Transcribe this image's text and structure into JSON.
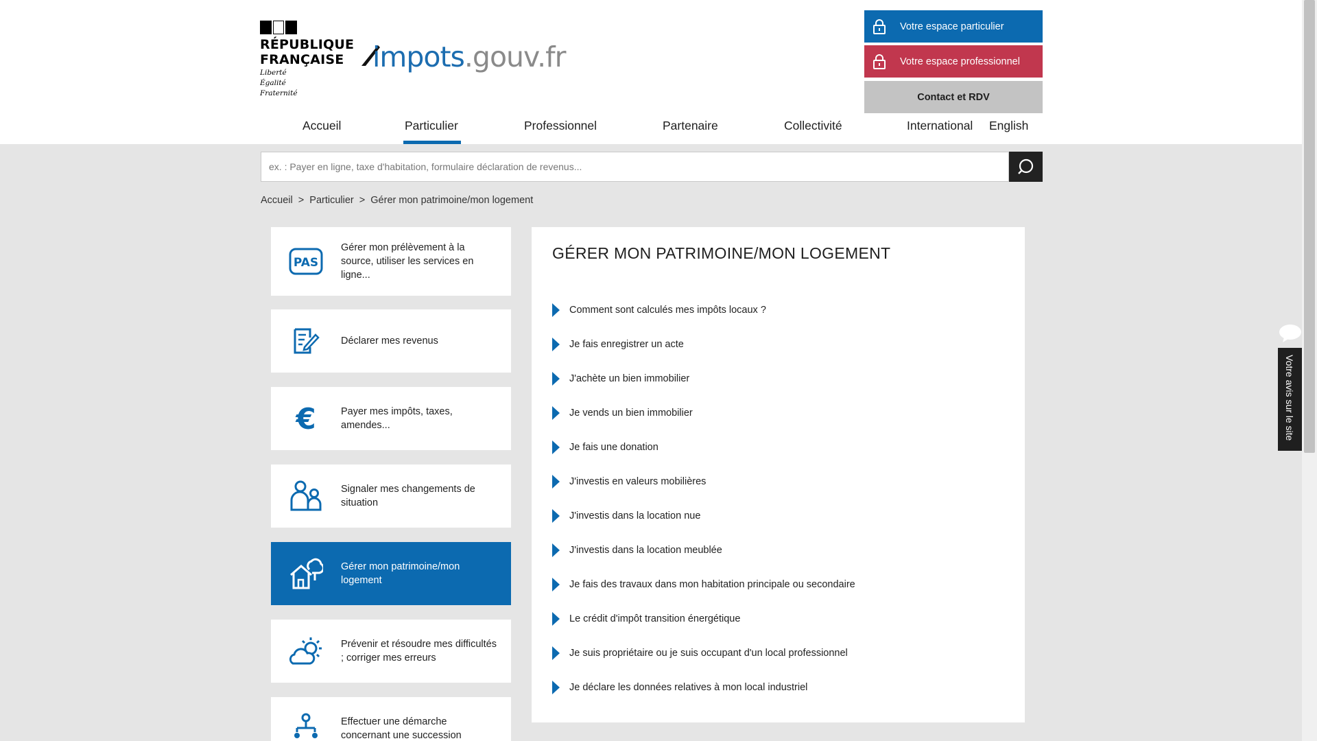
{
  "header": {
    "republic_line1": "RÉPUBLIQUE",
    "republic_line2": "FRANÇAISE",
    "motto": [
      "Liberté",
      "Égalité",
      "Fraternité"
    ],
    "logo_text_main": "impots",
    "logo_text_domain": ".gouv.fr",
    "buttons": {
      "particulier": "Votre espace particulier",
      "professionnel": "Votre espace professionnel",
      "contact": "Contact et RDV"
    },
    "nav": [
      "Accueil",
      "Particulier",
      "Professionnel",
      "Partenaire",
      "Collectivité",
      "International",
      "English"
    ],
    "nav_active": "Particulier"
  },
  "search": {
    "placeholder": "ex. : Payer en ligne, taxe d'habitation, formulaire déclaration de revenus..."
  },
  "breadcrumb": [
    "Accueil",
    ">",
    "Particulier",
    ">",
    "Gérer mon patrimoine/mon logement"
  ],
  "sidebar": {
    "cards": [
      {
        "label": "Gérer mon prélèvement à la source, utiliser les services en ligne...",
        "icon": "pas-icon"
      },
      {
        "label": "Déclarer mes revenus",
        "icon": "declaration-icon"
      },
      {
        "label": "Payer mes impôts, taxes, amendes...",
        "icon": "euro-icon"
      },
      {
        "label": "Signaler mes changements de situation",
        "icon": "family-icon"
      },
      {
        "label": "Gérer mon patrimoine/mon logement",
        "icon": "house-tree-icon"
      },
      {
        "label": "Prévenir et résoudre mes difficultés ; corriger mes erreurs",
        "icon": "sun-cloud-icon"
      },
      {
        "label": "Effectuer une démarche concernant une succession",
        "icon": "succession-icon"
      }
    ],
    "active_index": 4
  },
  "panel": {
    "title": "GÉRER MON PATRIMOINE/MON LOGEMENT",
    "links": [
      "Comment sont calculés mes impôts locaux ?",
      "Je fais enregistrer un acte",
      "J'achète un bien immobilier",
      "Je vends un bien immobilier",
      "Je fais une donation",
      "J'investis en valeurs mobilières",
      "J'investis dans la location nue",
      "J'investis dans la location meublée",
      "Je fais des travaux dans mon habitation principale ou secondaire",
      "Le crédit d'impôt transition énergétique",
      "Je suis propriétaire ou je suis occupant d'un local professionnel",
      "Je déclare les données relatives à mon local industriel"
    ]
  },
  "feedback": {
    "label": "Votre avis sur le site"
  },
  "colors": {
    "primary_blue": "#0c6ab0",
    "pro_red": "#c1374e",
    "contact_grey": "#c3c3c3",
    "background": "#e5e5e5"
  }
}
